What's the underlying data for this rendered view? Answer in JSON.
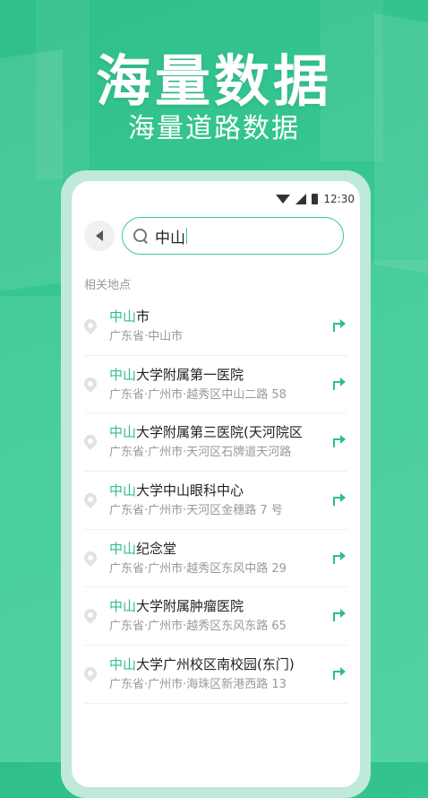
{
  "hero": {
    "title": "海量数据",
    "subtitle": "海量道路数据"
  },
  "status_bar": {
    "time": "12:30"
  },
  "search": {
    "value": "中山",
    "icon": "search-icon"
  },
  "section_label": "相关地点",
  "results": [
    {
      "highlight": "中山",
      "rest": "市",
      "address": "广东省·中山市"
    },
    {
      "highlight": "中山",
      "rest": "大学附属第一医院",
      "address": "广东省·广州市·越秀区中山二路 58"
    },
    {
      "highlight": "中山",
      "rest": "大学附属第三医院(天河院区",
      "address": "广东省·广州市·天河区石牌道天河路"
    },
    {
      "highlight": "中山",
      "rest": "大学中山眼科中心",
      "address": "广东省·广州市·天河区金穗路 7 号"
    },
    {
      "highlight": "中山",
      "rest": "纪念堂",
      "address": "广东省·广州市·越秀区东风中路 29"
    },
    {
      "highlight": "中山",
      "rest": "大学附属肿瘤医院",
      "address": "广东省·广州市·越秀区东风东路 65"
    },
    {
      "highlight": "中山",
      "rest": "大学广州校区南校园(东门)",
      "address": "广东省·广州市·海珠区新港西路 13"
    }
  ],
  "colors": {
    "accent": "#2fbf8a",
    "background": "#39c994"
  }
}
